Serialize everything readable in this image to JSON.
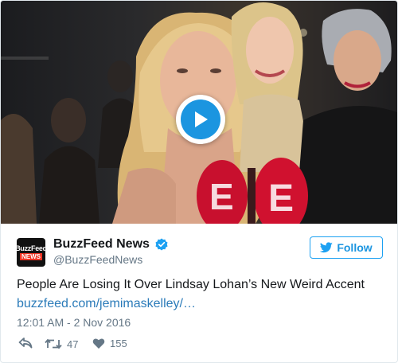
{
  "media": {
    "type": "video",
    "play_icon": "play-icon"
  },
  "author": {
    "name": "BuzzFeed News",
    "handle": "@BuzzFeedNews",
    "verified": true,
    "avatar_line1": "BuzzFeed",
    "avatar_line2": "NEWS",
    "verified_icon": "verified-badge-icon"
  },
  "follow_button": {
    "label": "Follow",
    "icon": "bird-icon"
  },
  "tweet": {
    "text": "People Are Losing It Over Lindsay Lohan’s New Weird Accent",
    "link": "buzzfeed.com/jemimaskelley/…",
    "timestamp": "12:01 AM - 2 Nov 2016"
  },
  "actions": {
    "reply_icon": "reply-icon",
    "retweet_icon": "retweet-icon",
    "retweet_count": "47",
    "like_icon": "heart-icon",
    "like_count": "155"
  },
  "colors": {
    "accent": "#1da1f2",
    "play_button": "#1b95e0",
    "link": "#2b7bb9",
    "muted_text": "#657786",
    "avatar_red": "#ee3322",
    "mic_red": "#c8102e"
  }
}
